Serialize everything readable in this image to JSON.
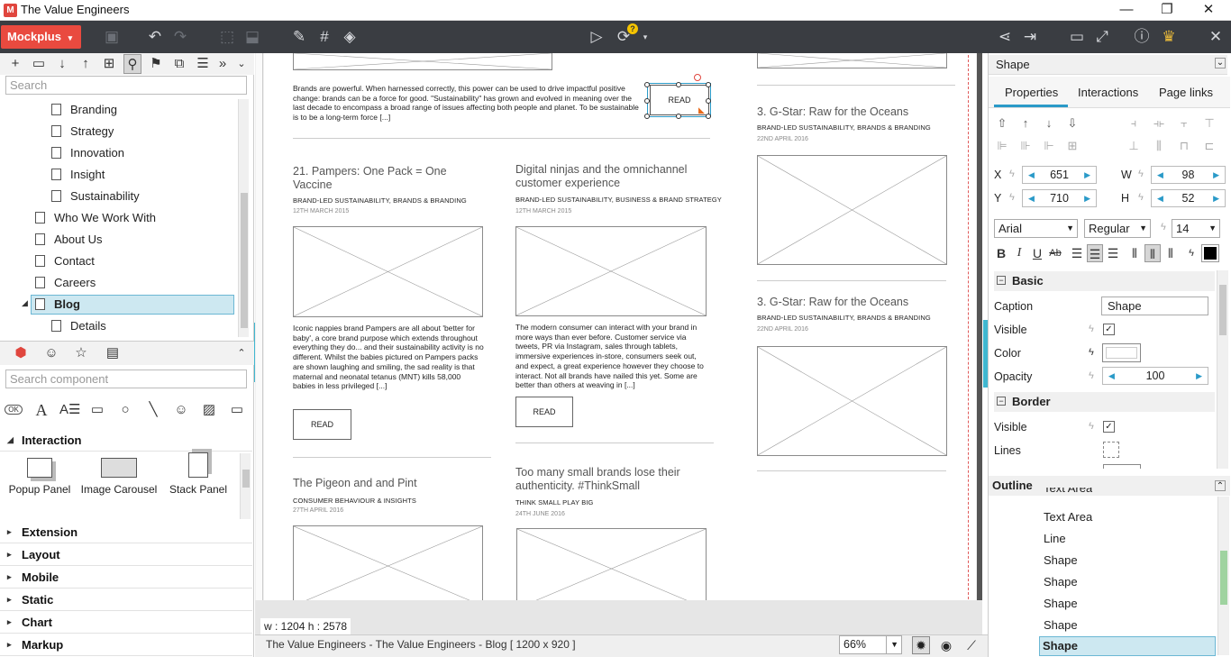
{
  "window": {
    "title": "The Value Engineers",
    "minimize": "—",
    "restore": "❐",
    "close": "✕"
  },
  "toolbar": {
    "brand_label": "Mockplus",
    "brand_caret": "▾",
    "badge": "?"
  },
  "sitemap": {
    "search_placeholder": "Search",
    "items": [
      {
        "label": "Branding",
        "level": 2
      },
      {
        "label": "Strategy",
        "level": 2
      },
      {
        "label": "Innovation",
        "level": 2
      },
      {
        "label": "Insight",
        "level": 2
      },
      {
        "label": "Sustainability",
        "level": 2
      },
      {
        "label": "Who We Work With",
        "level": 1
      },
      {
        "label": "About Us",
        "level": 1
      },
      {
        "label": "Contact",
        "level": 1
      },
      {
        "label": "Careers",
        "level": 1
      },
      {
        "label": "Blog",
        "level": 1,
        "selected": true
      },
      {
        "label": "Details",
        "level": 2
      }
    ]
  },
  "components": {
    "search_placeholder": "Search component",
    "section_interaction": "Interaction",
    "interaction_items": [
      "Popup Panel",
      "Image Carousel",
      "Stack Panel"
    ],
    "sections": [
      "Extension",
      "Layout",
      "Mobile",
      "Static",
      "Chart",
      "Markup"
    ],
    "ok_label": "OK"
  },
  "canvas": {
    "top_body": "Brands are powerful. When harnessed correctly, this power can be used to drive impactful positive change: brands can be a force for good. \"Sustainability\" has grown and evolved in meaning over the last decade to encompass a broad range of issues affecting both people and planet. To be sustainable is to be a long-term force [...]",
    "selected_read": "READ",
    "articles": [
      {
        "title": "21. Pampers: One Pack = One Vaccine",
        "category": "BRAND-LED SUSTAINABILITY, BRANDS & BRANDING",
        "date": "12TH MARCH 2015",
        "body": "Iconic nappies brand Pampers are all about 'better for baby', a core brand purpose which extends throughout everything they do... and their sustainability activity is no different. Whilst the babies pictured on Pampers packs are shown laughing and smiling, the sad reality is that maternal and neonatal tetanus (MNT) kills 58,000 babies in less privileged [...]",
        "read": "READ"
      },
      {
        "title": "Digital ninjas and the omnichannel customer experience",
        "category": "BRAND-LED SUSTAINABILITY, BUSINESS & BRAND STRATEGY",
        "date": "12TH MARCH 2015",
        "body": "The modern consumer can interact with your brand in more ways than ever before. Customer service via tweets, PR via Instagram, sales through tablets, immersive experiences in-store, consumers seek out, and expect, a great experience however they choose to interact. Not all brands have nailed this yet. Some are better than others at weaving in [...]",
        "read": "READ"
      },
      {
        "title": "The Pigeon and and Pint",
        "category": "CONSUMER BEHAVIOUR & INSIGHTS",
        "date": "27TH APRIL 2016"
      },
      {
        "title": "Too many small brands lose their authenticity. #ThinkSmall",
        "category": "THINK SMALL PLAY BIG",
        "date": "24TH JUNE 2016"
      }
    ],
    "side_articles": [
      {
        "title": "3. G-Star: Raw for the Oceans",
        "category": "BRAND-LED SUSTAINABILITY, BRANDS & BRANDING",
        "date": "22ND APRIL 2016"
      },
      {
        "title": "3. G-Star: Raw for the Oceans",
        "category": "BRAND-LED SUSTAINABILITY, BRANDS & BRANDING",
        "date": "22ND APRIL 2016"
      }
    ]
  },
  "status": {
    "canvas_size": "w : 1204  h : 2578",
    "page_info": "The Value Engineers - The Value Engineers - Blog [ 1200 x 920 ]",
    "zoom": "66%"
  },
  "inspector": {
    "header": "Shape",
    "tabs": [
      "Properties",
      "Interactions",
      "Page links"
    ],
    "x_label": "X",
    "x_value": "651",
    "y_label": "Y",
    "y_value": "710",
    "w_label": "W",
    "w_value": "98",
    "h_label": "H",
    "h_value": "52",
    "font_family": "Arial",
    "font_style": "Regular",
    "font_size": "14",
    "basic_label": "Basic",
    "caption_label": "Caption",
    "caption_value": "Shape",
    "visible_label": "Visible",
    "color_label": "Color",
    "opacity_label": "Opacity",
    "opacity_value": "100",
    "border_label": "Border",
    "border_visible_label": "Visible",
    "lines_label": "Lines",
    "text_color": "#000000",
    "fill_color": "#ffffff"
  },
  "outline": {
    "title": "Outline",
    "items": [
      "Text Area",
      "Text Area",
      "Line",
      "Shape",
      "Shape",
      "Shape",
      "Shape",
      "Shape"
    ]
  },
  "colors": {
    "brand": "#e94a3f",
    "toolbar": "#3a3d42",
    "accent": "#2a9ac8",
    "selection": "#cde8f1"
  }
}
